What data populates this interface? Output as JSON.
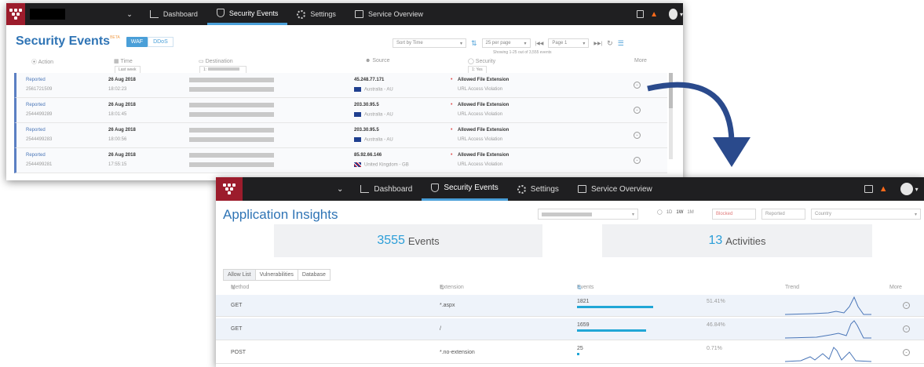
{
  "colors": {
    "accent": "#4a9fd8",
    "title": "#2f74b5",
    "bar": "#21a6d6",
    "bell": "#ff6a1a",
    "logo": "#9c1c2c"
  },
  "nav": {
    "dashboard": "Dashboard",
    "security_events": "Security Events",
    "settings": "Settings",
    "service_overview": "Service Overview",
    "dropdown_icon": "chevron-down-icon",
    "notifications_icon": "bell-icon"
  },
  "security_events": {
    "title": "Security Events",
    "beta": "BETA",
    "tabs": [
      "WAF",
      "DDoS"
    ],
    "sort": "Sort by Time",
    "per_page": "25 per page",
    "page": "Page 1",
    "showing": "Showing 1-25 out of 3,555 events",
    "columns": {
      "action": "Action",
      "time": "Time",
      "destination": "Destination",
      "source": "Source",
      "security": "Security",
      "more": "More"
    },
    "filters": {
      "time": "Last week",
      "destination": "1:",
      "security": "1: Yes"
    },
    "rows": [
      {
        "action": "Reported",
        "id": "2561721509",
        "date": "26 Aug 2018",
        "time": "18:02:23",
        "ip": "45.248.77.171",
        "country": "Australia - AU",
        "flag": "au",
        "rule": "Allowed File Extension",
        "violation": "URL Access Violation"
      },
      {
        "action": "Reported",
        "id": "2544499289",
        "date": "26 Aug 2018",
        "time": "18:01:45",
        "ip": "203.30.95.5",
        "country": "Australia - AU",
        "flag": "au",
        "rule": "Allowed File Extension",
        "violation": "URL Access Violation"
      },
      {
        "action": "Reported",
        "id": "2544499283",
        "date": "26 Aug 2018",
        "time": "18:00:56",
        "ip": "203.30.95.5",
        "country": "Australia - AU",
        "flag": "au",
        "rule": "Allowed File Extension",
        "violation": "URL Access Violation"
      },
      {
        "action": "Reported",
        "id": "2544499281",
        "date": "26 Aug 2018",
        "time": "17:55:15",
        "ip": "85.92.66.146",
        "country": "United Kingdom - GB",
        "flag": "gb",
        "rule": "Allowed File Extension",
        "violation": "URL Access Violation"
      }
    ]
  },
  "app_insights": {
    "title": "Application Insights",
    "range": [
      "1D",
      "1W",
      "1M"
    ],
    "range_selected": "1W",
    "blocked": "Blocked",
    "reported": "Reported",
    "country_placeholder": "Country",
    "events_count": "3555",
    "events_label": "Events",
    "activities_count": "13",
    "activities_label": "Activities",
    "tabs": [
      "Allow List",
      "Vulnerabilities",
      "Database"
    ],
    "columns": {
      "method": "Method",
      "extension": "Extension",
      "events": "Events",
      "trend": "Trend",
      "more": "More"
    },
    "rows": [
      {
        "method": "GET",
        "extension": "*.aspx",
        "events": "1821",
        "percent": "51.41%",
        "fraction": 0.5141
      },
      {
        "method": "GET",
        "extension": "/",
        "events": "1659",
        "percent": "46.84%",
        "fraction": 0.4684
      },
      {
        "method": "POST",
        "extension": "*.no-extension",
        "events": "25",
        "percent": "0.71%",
        "fraction": 0.0071
      }
    ]
  }
}
